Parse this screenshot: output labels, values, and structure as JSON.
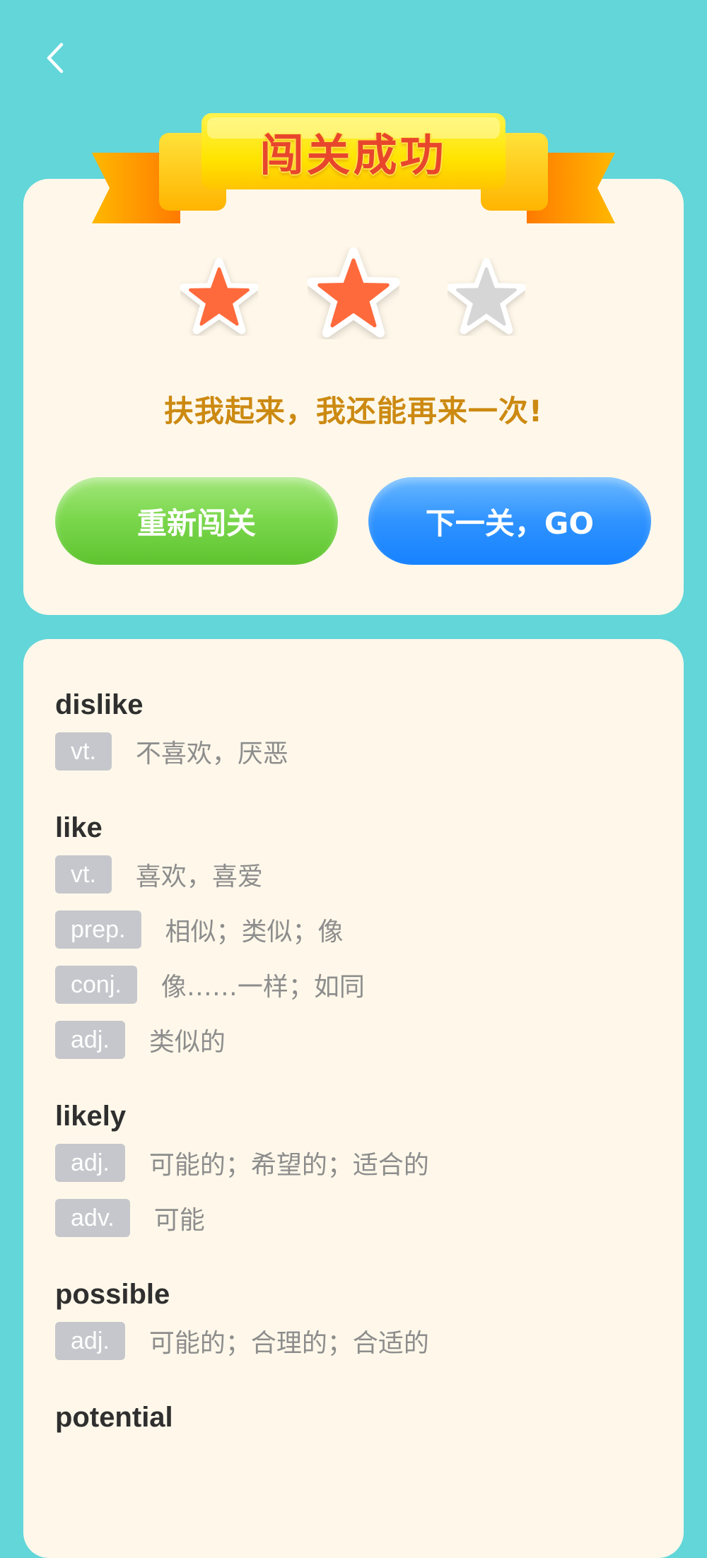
{
  "header": {
    "back_icon": "chevron-left-icon"
  },
  "result": {
    "banner_title": "闯关成功",
    "stars_earned": 2,
    "stars_total": 3,
    "star_color_filled": "#ff6a3c",
    "star_color_empty": "#d6d6d6",
    "message": "扶我起来，我还能再来一次!",
    "retry_label": "重新闯关",
    "next_label": "下一关，GO"
  },
  "words": [
    {
      "word": "dislike",
      "defs": [
        {
          "pos": "vt.",
          "meaning": "不喜欢，厌恶"
        }
      ]
    },
    {
      "word": "like",
      "defs": [
        {
          "pos": "vt.",
          "meaning": "喜欢，喜爱"
        },
        {
          "pos": "prep.",
          "meaning": "相似；类似；像"
        },
        {
          "pos": "conj.",
          "meaning": "像……一样；如同"
        },
        {
          "pos": "adj.",
          "meaning": "类似的"
        }
      ]
    },
    {
      "word": "likely",
      "defs": [
        {
          "pos": "adj.",
          "meaning": "可能的；希望的；适合的"
        },
        {
          "pos": "adv.",
          "meaning": "可能"
        }
      ]
    },
    {
      "word": "possible",
      "defs": [
        {
          "pos": "adj.",
          "meaning": "可能的；合理的；合适的"
        }
      ]
    },
    {
      "word": "potential",
      "defs": []
    }
  ]
}
